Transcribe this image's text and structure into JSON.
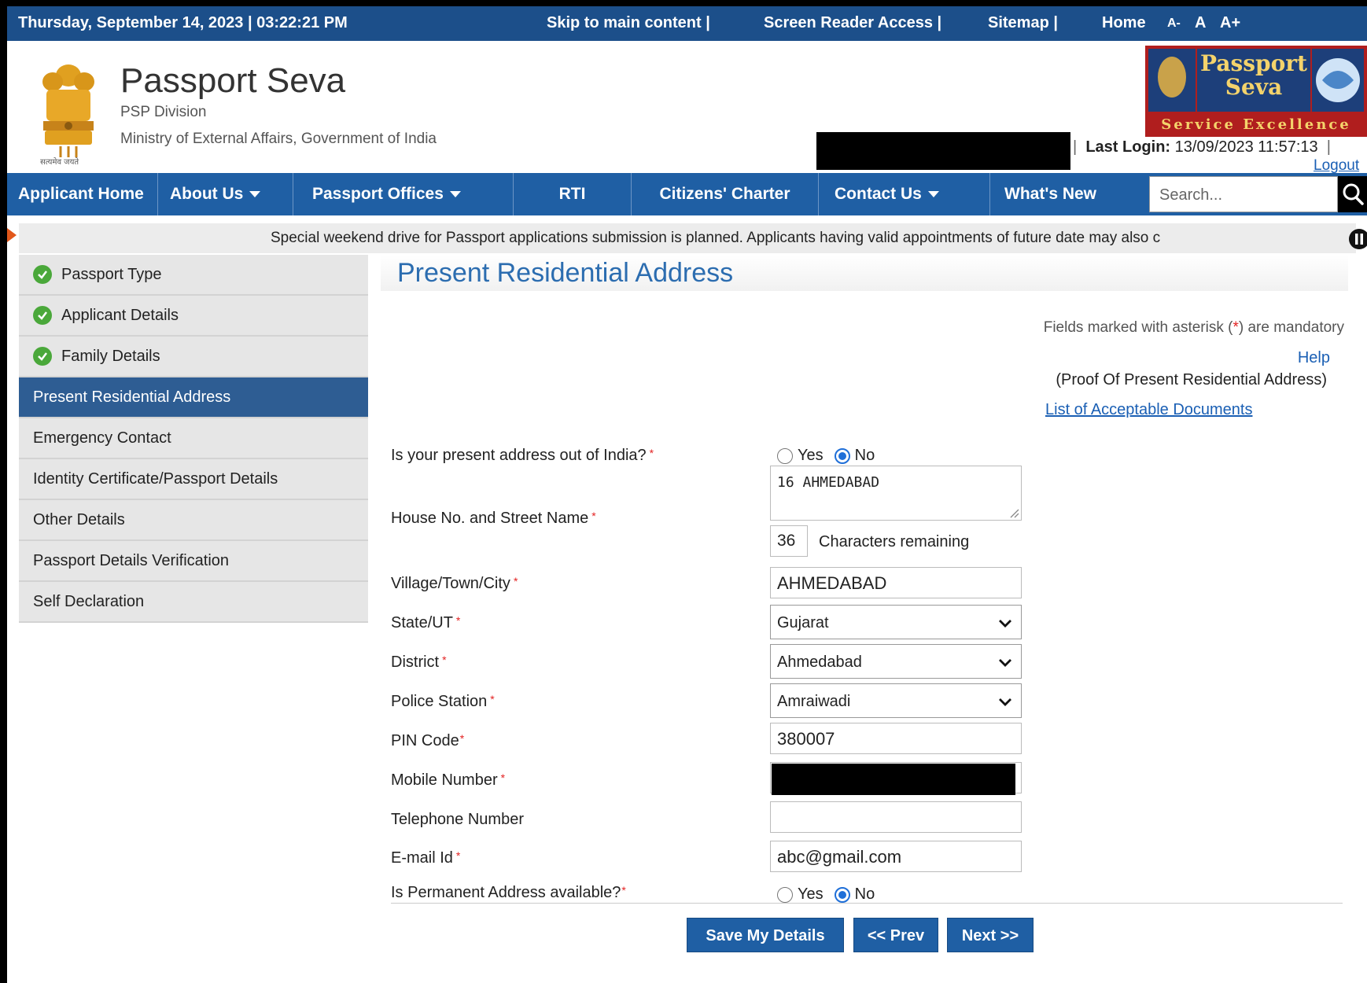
{
  "topbar": {
    "datetime": "Thursday,  September  14, 2023 | 03:22:21 PM",
    "skip": "Skip to main content  |",
    "screen_reader": "Screen Reader Access  |",
    "sitemap": "Sitemap   |",
    "home": "Home",
    "font_small": "A-",
    "font_normal": "A",
    "font_large": "A+"
  },
  "header": {
    "title": "Passport Seva",
    "division": "PSP Division",
    "ministry": "Ministry of External Affairs, Government of India",
    "emblem_motto": "सत्यमेव जयते",
    "logo_title_1": "Passport",
    "logo_title_2": "Seva",
    "logo_tagline": "Service Excellence",
    "last_login_label": "Last Login:",
    "last_login_value": "13/09/2023 11:57:13",
    "logout": "Logout"
  },
  "nav": {
    "items": [
      {
        "label": "Applicant Home"
      },
      {
        "label": "About Us"
      },
      {
        "label": "Passport Offices"
      },
      {
        "label": "RTI"
      },
      {
        "label": "Citizens' Charter"
      },
      {
        "label": "Contact Us"
      },
      {
        "label": "What's New"
      }
    ],
    "search_placeholder": "Search..."
  },
  "ticker": {
    "text": "Special weekend drive for Passport applications submission is planned. Applicants having valid appointments of future date may also c"
  },
  "sidebar": {
    "items": [
      {
        "label": "Passport Type",
        "done": true
      },
      {
        "label": "Applicant Details",
        "done": true
      },
      {
        "label": "Family Details",
        "done": true
      },
      {
        "label": "Present Residential Address",
        "active": true
      },
      {
        "label": "Emergency Contact"
      },
      {
        "label": "Identity Certificate/Passport Details"
      },
      {
        "label": "Other Details"
      },
      {
        "label": "Passport Details Verification"
      },
      {
        "label": "Self Declaration"
      }
    ]
  },
  "main": {
    "title": "Present Residential Address",
    "mandatory_note": "Fields marked with asterisk (*) are mandatory",
    "help": "Help",
    "proof": "(Proof Of Present Residential Address)",
    "docs_link": "List of Acceptable Documents",
    "asterisk": "*",
    "form": {
      "out_of_india_label": "Is your present address out of India?",
      "yes": "Yes",
      "no": "No",
      "out_of_india_value": "No",
      "house_label": "House No. and Street Name",
      "house_value": "16  AHMEDABAD",
      "chars_remaining_count": "36",
      "chars_remaining_label": "Characters remaining",
      "city_label": "Village/Town/City",
      "city_value": "AHMEDABAD",
      "state_label": "State/UT",
      "state_value": "Gujarat",
      "district_label": "District",
      "district_value": "Ahmedabad",
      "police_label": "Police Station",
      "police_value": "Amraiwadi",
      "pin_label": "PIN Code",
      "pin_value": "380007",
      "mobile_label": "Mobile Number",
      "telephone_label": "Telephone Number",
      "telephone_value": "",
      "email_label": "E-mail Id",
      "email_value": "abc@gmail.com",
      "permanent_label": "Is Permanent Address available?",
      "permanent_value": "No"
    },
    "buttons": {
      "save": "Save My Details",
      "prev": "<< Prev",
      "next": "Next >>"
    }
  },
  "colors": {
    "topbar": "#1c4f8a",
    "nav": "#1f5fa4",
    "active_sidebar": "#2e5d93",
    "title_blue": "#2c6db0",
    "check_green": "#4aa83a",
    "required_red": "#e32222"
  }
}
